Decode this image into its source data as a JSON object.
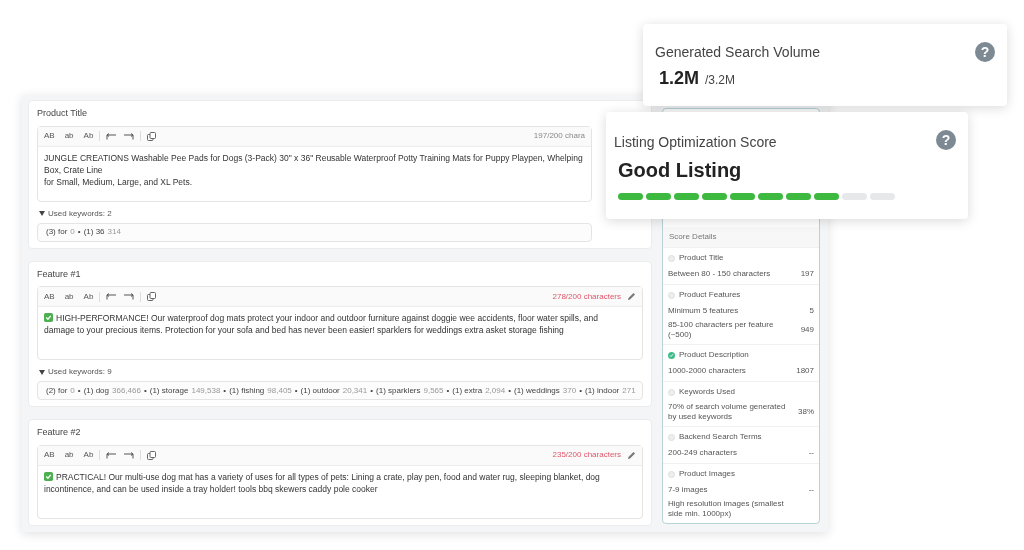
{
  "sections": [
    {
      "label": "Product Title",
      "tools": [
        "AB",
        "ab",
        "Ab"
      ],
      "char_count": "197/200 chara",
      "over_limit": false,
      "has_check": false,
      "show_pencil": false,
      "lines": [
        "JUNGLE CREATIONS Washable Pee Pads for Dogs (3-Pack) 30\" x 36\" Reusable Waterproof Potty Training Mats for Puppy Playpen, Whelping Box, Crate Line",
        "for Small, Medium, Large, and XL Pets."
      ],
      "keywords_label": "Used keywords: 2",
      "keywords": [
        {
          "count": "(3)",
          "word": "for",
          "volume": "0"
        },
        {
          "count": "(1)",
          "word": "36",
          "volume": "314"
        }
      ]
    },
    {
      "label": "Feature #1",
      "tools": [
        "AB",
        "ab",
        "Ab"
      ],
      "char_count": "278/200 characters",
      "over_limit": true,
      "has_check": true,
      "show_pencil": true,
      "lines": [
        "HIGH-PERFORMANCE! Our waterproof dog mats protect your indoor and outdoor furniture against doggie wee accidents, floor water spills, and damage to your precious items. Protection for your sofa and bed has never been easier! sparklers for weddings extra asket storage fishing"
      ],
      "keywords_label": "Used keywords: 9",
      "keywords": [
        {
          "count": "(2)",
          "word": "for",
          "volume": "0"
        },
        {
          "count": "(1)",
          "word": "dog",
          "volume": "366,466"
        },
        {
          "count": "(1)",
          "word": "storage",
          "volume": "149,538"
        },
        {
          "count": "(1)",
          "word": "fishing",
          "volume": "98,405"
        },
        {
          "count": "(1)",
          "word": "outdoor",
          "volume": "20,341"
        },
        {
          "count": "(1)",
          "word": "sparklers",
          "volume": "9,565"
        },
        {
          "count": "(1)",
          "word": "extra",
          "volume": "2,094"
        },
        {
          "count": "(1)",
          "word": "weddings",
          "volume": "370"
        },
        {
          "count": "(1)",
          "word": "indoor",
          "volume": "271"
        }
      ]
    },
    {
      "label": "Feature #2",
      "tools": [
        "AB",
        "ab",
        "Ab"
      ],
      "char_count": "235/200 characters",
      "over_limit": true,
      "has_check": true,
      "show_pencil": true,
      "lines": [
        "PRACTICAL! Our multi-use dog mat has a variety of uses for all types of pets: Lining a crate, play pen, food and water rug, sleeping blanket, dog incontinence, and can be used inside a tray holder! tools bbq skewers caddy pole cooker"
      ]
    }
  ],
  "keyword_separator": "•",
  "score_details": {
    "title": "Score Details",
    "groups": [
      {
        "name": "Product Title",
        "met": false,
        "rows": [
          {
            "label": "Between 80 - 150 characters",
            "value": "197"
          }
        ]
      },
      {
        "name": "Product Features",
        "met": false,
        "rows": [
          {
            "label": "Minimum 5 features",
            "value": "5"
          },
          {
            "label": "85-100 characters per feature (~500)",
            "value": "949"
          }
        ]
      },
      {
        "name": "Product Description",
        "met": true,
        "rows": [
          {
            "label": "1000-2000 characters",
            "value": "1807"
          }
        ]
      },
      {
        "name": "Keywords Used",
        "met": false,
        "rows": [
          {
            "label": "70% of search volume generated by used keywords",
            "value": "38%"
          }
        ]
      },
      {
        "name": "Backend Search Terms",
        "met": false,
        "rows": [
          {
            "label": "200-249 characters",
            "value": "--"
          }
        ]
      },
      {
        "name": "Product Images",
        "met": false,
        "rows": [
          {
            "label": "7-9 images",
            "value": "--"
          },
          {
            "label": "High resolution images (smallest side min. 1000px)"
          }
        ]
      }
    ]
  },
  "search_volume": {
    "title": "Generated Search Volume",
    "value": "1.2M",
    "total": "/3.2M",
    "help": "?"
  },
  "optimization_score": {
    "title": "Listing Optimization Score",
    "rating": "Good Listing",
    "help": "?",
    "level": 0.8
  }
}
